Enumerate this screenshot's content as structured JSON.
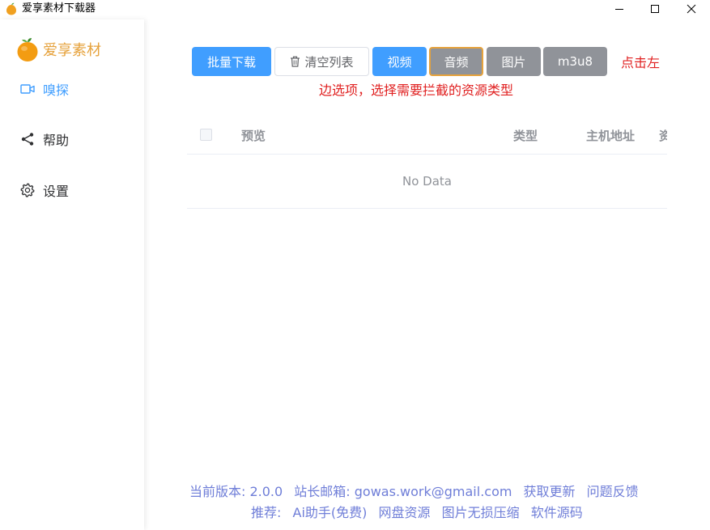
{
  "window": {
    "title": "爱享素材下载器",
    "icon": "orange-fruit-icon"
  },
  "sidebar": {
    "brand": "爱享素材",
    "items": [
      {
        "label": "嗅探",
        "icon": "video-camera-icon",
        "active": true
      },
      {
        "label": "帮助",
        "icon": "share-icon",
        "active": false
      },
      {
        "label": "设置",
        "icon": "gear-icon",
        "active": false
      }
    ]
  },
  "toolbar": {
    "batch_download": "批量下载",
    "clear_list": "清空列表",
    "filters": [
      "视频",
      "音频",
      "图片",
      "m3u8"
    ],
    "hint_line1": "点击左",
    "hint_line2": "边选项，选择需要拦截的资源类型"
  },
  "table": {
    "columns": [
      "预览",
      "类型",
      "主机地址",
      "资"
    ],
    "empty_text": "No Data"
  },
  "footer": {
    "version": "当前版本: 2.0.0",
    "email": "站长邮箱: gowas.work@gmail.com",
    "update": "获取更新",
    "feedback": "问题反馈",
    "recommend": "推荐:",
    "links": [
      "Ai助手(免费)",
      "网盘资源",
      "图片无损压缩",
      "软件源码"
    ]
  },
  "colors": {
    "primary": "#409eff",
    "info": "#909399",
    "warning": "#e6a23c",
    "hint": "#e02020",
    "footer_link": "#6f7ed8"
  }
}
